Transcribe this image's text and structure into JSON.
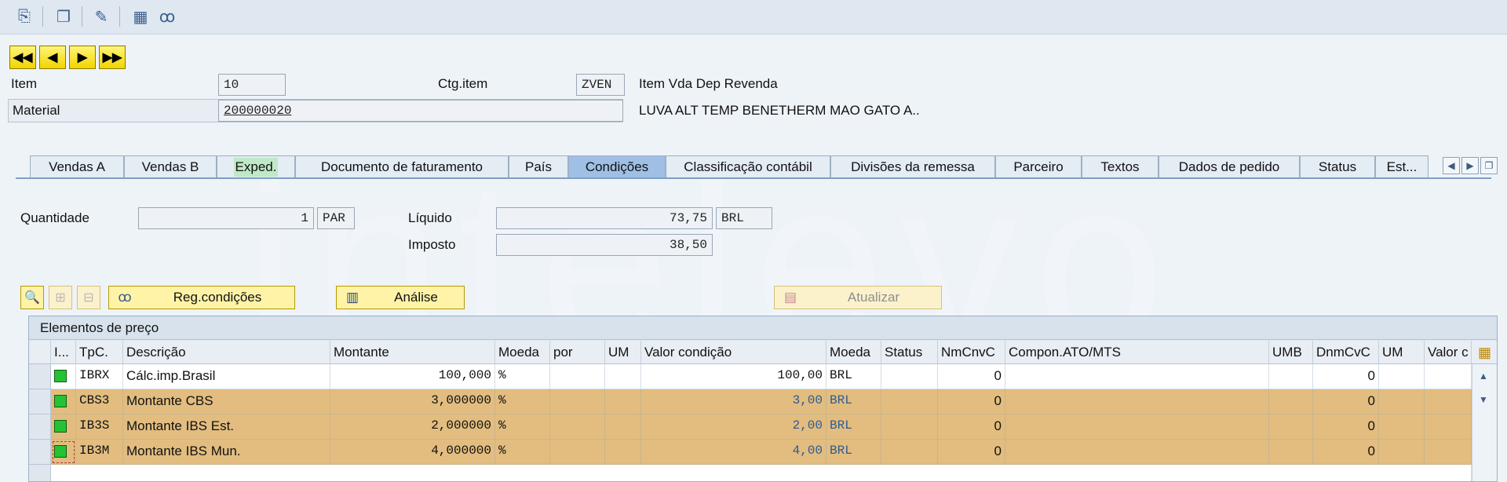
{
  "toolbar": {
    "icons": [
      "copy-doc-icon",
      "display-doc-icon",
      "edit-doc-icon",
      "calculator-icon",
      "glasses-icon"
    ]
  },
  "nav": {
    "first": "◀◀",
    "prev": "◀",
    "next": "▶",
    "last": "▶▶"
  },
  "header": {
    "item_label": "Item",
    "item_value": "10",
    "ctg_label": "Ctg.item",
    "ctg_value": "ZVEN",
    "ctg_desc": "Item Vda Dep Revenda",
    "material_label": "Material",
    "material_value": "200000020",
    "material_desc": "LUVA ALT TEMP BENETHERM MAO GATO A.."
  },
  "tabs": [
    {
      "label": "Vendas A"
    },
    {
      "label": "Vendas B"
    },
    {
      "label": "Exped."
    },
    {
      "label": "Documento de faturamento"
    },
    {
      "label": "País"
    },
    {
      "label": "Condições"
    },
    {
      "label": "Classificação contábil"
    },
    {
      "label": "Divisões da remessa"
    },
    {
      "label": "Parceiro"
    },
    {
      "label": "Textos"
    },
    {
      "label": "Dados de pedido"
    },
    {
      "label": "Status"
    },
    {
      "label": "Est..."
    }
  ],
  "conditions": {
    "quantidade_label": "Quantidade",
    "quantidade_value": "1",
    "quantidade_unit": "PAR",
    "liquido_label": "Líquido",
    "liquido_value": "73,75",
    "liquido_currency": "BRL",
    "imposto_label": "Imposto",
    "imposto_value": "38,50",
    "buttons": {
      "reg": "Reg.condições",
      "analise": "Análise",
      "atualizar": "Atualizar"
    }
  },
  "grid": {
    "title": "Elementos de preço",
    "headers": [
      "I...",
      "TpC.",
      "Descrição",
      "Montante",
      "Moeda",
      "por",
      "UM",
      "Valor condição",
      "Moeda",
      "Status",
      "NmCnvC",
      "Compon.ATO/MTS",
      "UMB",
      "DnmCvC",
      "UM",
      "Valor c"
    ],
    "rows": [
      {
        "tpc": "IBRX",
        "desc": "Cálc.imp.Brasil",
        "montante": "100,000",
        "moeda": "%",
        "valor": "100,00",
        "moeda2": "BRL",
        "nm": "0",
        "dnm": "0"
      },
      {
        "tpc": "CBS3",
        "desc": "Montante CBS",
        "montante": "3,000000",
        "moeda": "%",
        "valor": "3,00",
        "moeda2": "BRL",
        "nm": "0",
        "dnm": "0"
      },
      {
        "tpc": "IB3S",
        "desc": "Montante IBS Est.",
        "montante": "2,000000",
        "moeda": "%",
        "valor": "2,00",
        "moeda2": "BRL",
        "nm": "0",
        "dnm": "0"
      },
      {
        "tpc": "IB3M",
        "desc": "Montante IBS Mun.",
        "montante": "4,000000",
        "moeda": "%",
        "valor": "4,00",
        "moeda2": "BRL",
        "nm": "0",
        "dnm": "0"
      }
    ]
  },
  "watermark": "intelevo"
}
